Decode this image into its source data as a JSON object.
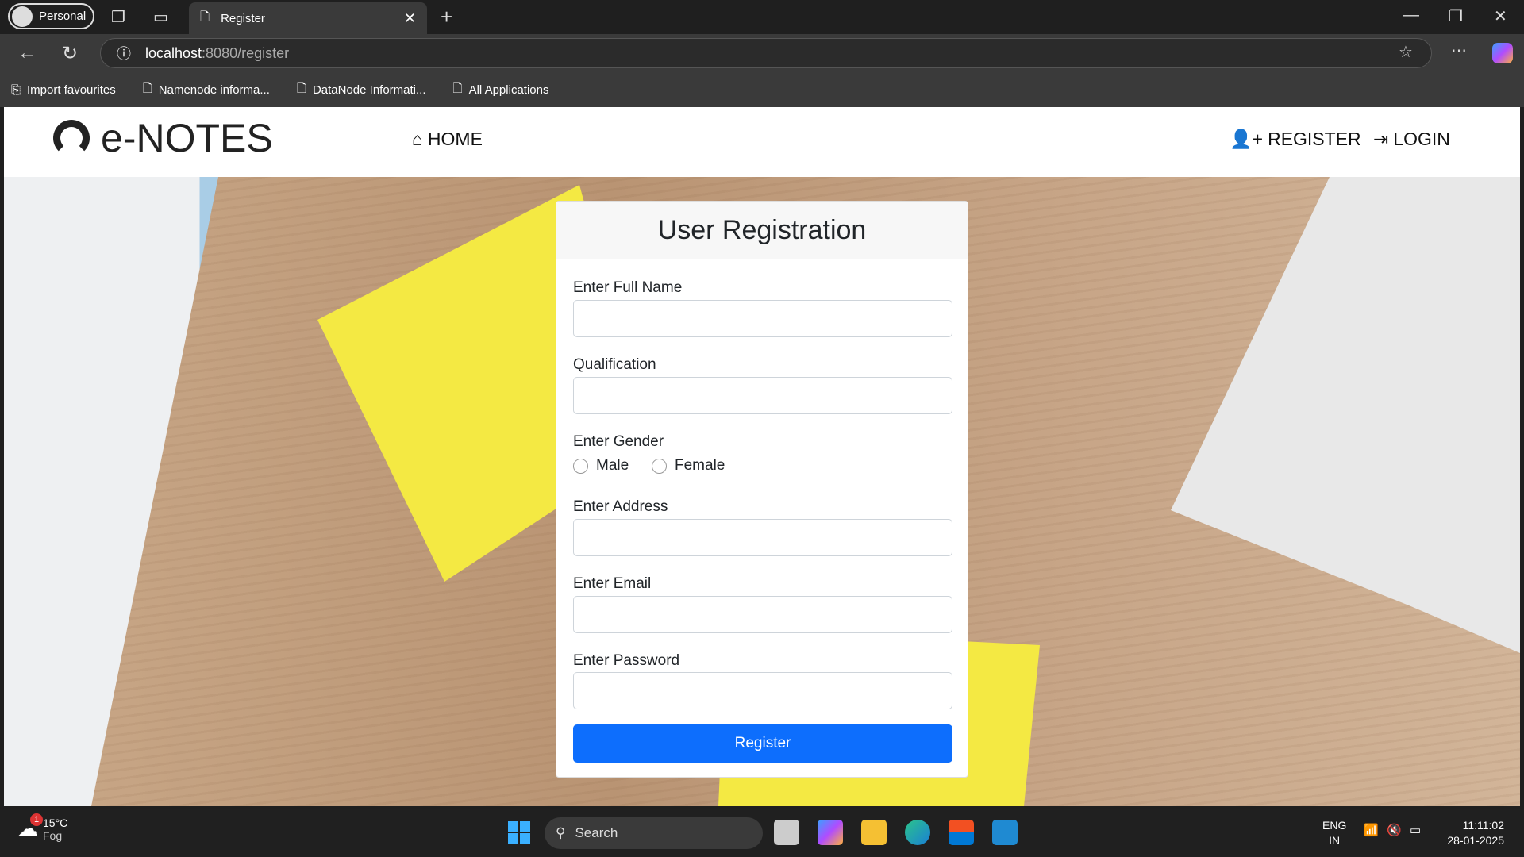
{
  "browser": {
    "profile": "Personal",
    "tab_title": "Register",
    "url_host": "localhost",
    "url_rest": ":8080/register",
    "bookmarks": [
      "Import favourites",
      "Namenode informa...",
      "DataNode Informati...",
      "All Applications"
    ]
  },
  "nav": {
    "brand": "e-NOTES",
    "home": "HOME",
    "register": "REGISTER",
    "login": "LOGIN"
  },
  "form": {
    "title": "User Registration",
    "full_name_label": "Enter Full Name",
    "qualification_label": "Qualification",
    "gender_label": "Enter Gender",
    "gender_options": [
      "Male",
      "Female"
    ],
    "address_label": "Enter Address",
    "email_label": "Enter Email",
    "password_label": "Enter Password",
    "submit": "Register"
  },
  "taskbar": {
    "temp": "15°C",
    "weather": "Fog",
    "weather_badge": "1",
    "search": "Search",
    "lang1": "ENG",
    "lang2": "IN",
    "time": "11:11:02",
    "date": "28-01-2025"
  }
}
